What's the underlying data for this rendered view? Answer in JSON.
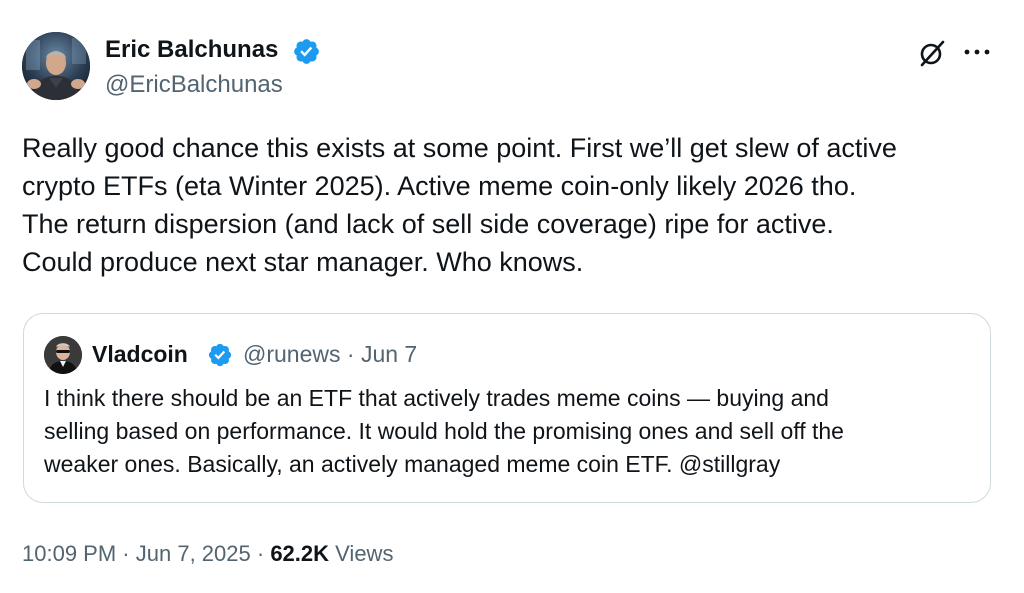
{
  "tweet": {
    "author": {
      "name": "Eric Balchunas",
      "handle": "@EricBalchunas",
      "verified": true
    },
    "text_lines": [
      "Really good chance this exists at some point. First we’ll get slew of active",
      "crypto ETFs (eta Winter 2025). Active meme coin-only likely 2026 tho.",
      "The return dispersion (and lack of sell side coverage) ripe for active.",
      "Could produce next star manager. Who knows."
    ],
    "icons": {
      "grok": "grok-icon",
      "more": "more-icon",
      "verified": "verified-badge-icon"
    },
    "quote": {
      "name": "Vladcoin",
      "handle": "@runews",
      "separator": "·",
      "date": "Jun 7",
      "text_lines": [
        "I think there should be an ETF that actively trades meme coins — buying and",
        "selling based on performance. It would hold the promising ones and sell off the",
        "weaker ones. Basically, an actively managed meme coin ETF. @stillgray"
      ]
    },
    "footer": {
      "time": "10:09 PM",
      "separator": "·",
      "date": "Jun 7, 2025",
      "views_count": "62.2K",
      "views_label": "Views"
    },
    "colors": {
      "text_primary": "#0f1419",
      "text_secondary": "#536471",
      "verified_blue": "#1d9bf0",
      "border": "#cfd9de"
    }
  }
}
